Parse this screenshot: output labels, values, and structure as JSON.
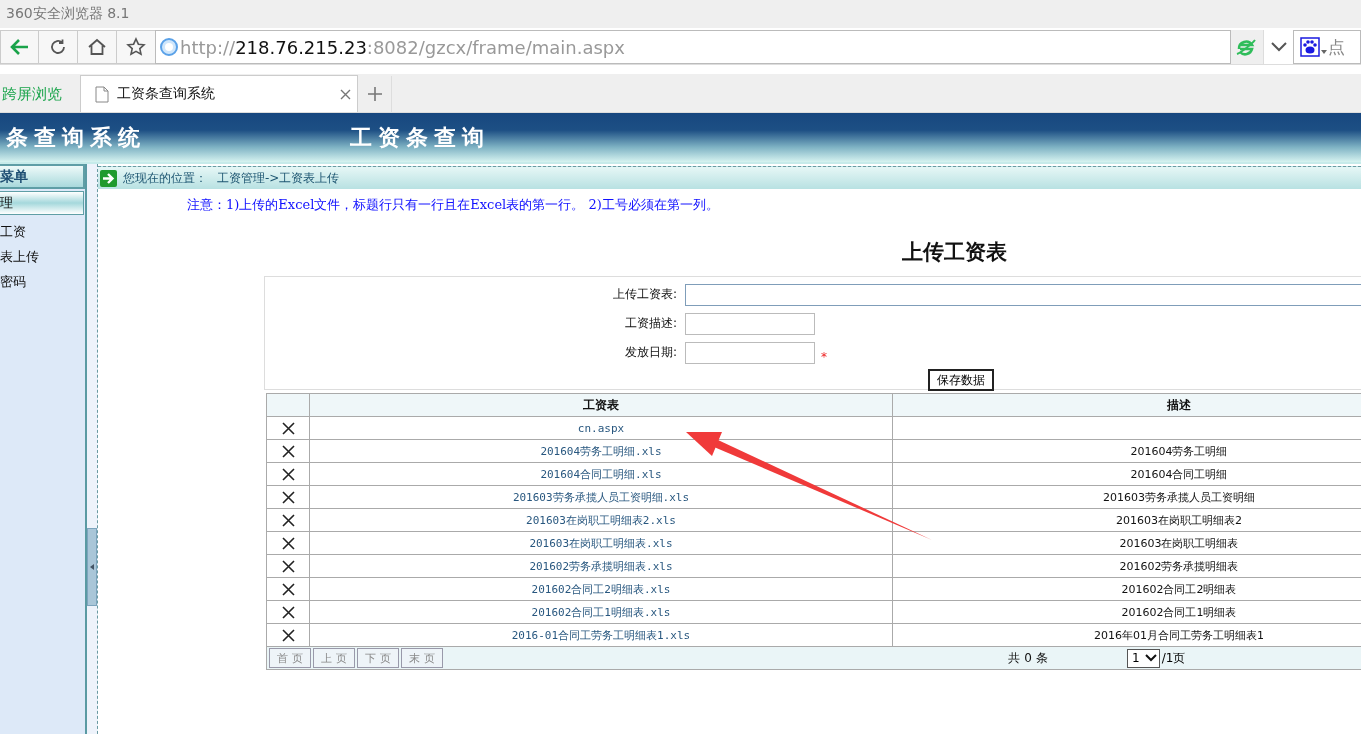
{
  "browser": {
    "title": "360安全浏览器 8.1",
    "url": {
      "scheme": "http://",
      "host": "218.76.215.23",
      "path": ":8082/gzcx/frame/main.aspx"
    },
    "search_text": "点"
  },
  "cross_screen": "跨屏浏览",
  "tabs": [
    {
      "label": "工资条查询系统",
      "selected": true
    }
  ],
  "header": {
    "system_title": "条查询系统",
    "page_title": "工资条查询"
  },
  "sidebar": {
    "heading": "菜单",
    "items": [
      {
        "label": "理",
        "selected": true
      },
      {
        "label": "工资",
        "selected": false
      },
      {
        "label": "表上传",
        "selected": false
      },
      {
        "label": "密码",
        "selected": false
      }
    ]
  },
  "breadcrumb": {
    "label": "您现在的位置：",
    "path": "工资管理->工资表上传"
  },
  "notice": "注意：1)上传的Excel文件，标题行只有一行且在Excel表的第一行。 2)工号必须在第一列。",
  "form_title": "上传工资表",
  "form": {
    "fields": [
      {
        "label": "上传工资表:",
        "kind": "file",
        "required": false
      },
      {
        "label": "工资描述:",
        "kind": "text",
        "required": false
      },
      {
        "label": "发放日期:",
        "kind": "text",
        "required": true
      }
    ],
    "required_mark": "*",
    "save_button": "保存数据"
  },
  "table": {
    "columns": [
      "工资表",
      "描述"
    ],
    "rows": [
      {
        "file": "cn.aspx"
      },
      {
        "file": "201604劳务工明细.xls",
        "description": "201604劳务工明细"
      },
      {
        "file": "201604合同工明细.xls",
        "description": "201604合同工明细"
      },
      {
        "file": "201603劳务承揽人员工资明细.xls",
        "description": "201603劳务承揽人员工资明细"
      },
      {
        "file": "201603在岗职工明细表2.xls",
        "description": "201603在岗职工明细表2"
      },
      {
        "file": "201603在岗职工明细表.xls",
        "description": "201603在岗职工明细表"
      },
      {
        "file": "201602劳务承揽明细表.xls",
        "description": "201602劳务承揽明细表"
      },
      {
        "file": "201602合同工2明细表.xls",
        "description": "201602合同工2明细表"
      },
      {
        "file": "201602合同工1明细表.xls",
        "description": "201602合同工1明细表"
      },
      {
        "file": "2016-01合同工劳务工明细表1.xls",
        "description": "2016年01月合同工劳务工明细表1"
      }
    ]
  },
  "pager": {
    "buttons": [
      {
        "label": "首 页",
        "disabled": true
      },
      {
        "label": "上 页",
        "disabled": true
      },
      {
        "label": "下 页",
        "disabled": true
      },
      {
        "label": "末 页",
        "disabled": true
      }
    ],
    "total": "共 0 条",
    "page": "1",
    "page_count": "/1页"
  },
  "annotation": {
    "kind": "arrow"
  }
}
